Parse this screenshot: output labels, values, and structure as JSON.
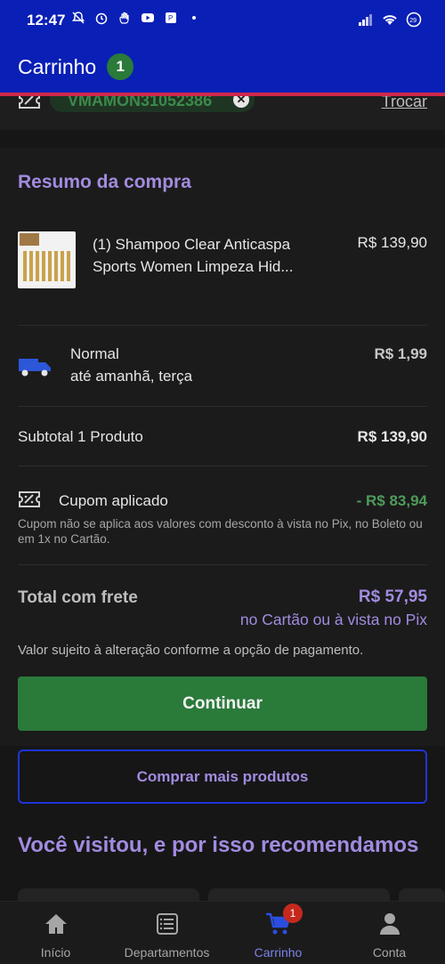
{
  "status_bar": {
    "time": "12:47",
    "battery": "29",
    "icons": [
      "mute-bell-icon",
      "alarm-icon",
      "hand-icon",
      "youtube-icon",
      "app-icon",
      "dot-icon",
      "signal-icon",
      "wifi-icon",
      "battery-icon"
    ]
  },
  "header": {
    "title": "Carrinho",
    "badge": "1",
    "bg_color": "#0a1fb5",
    "accent_line": "#d1284a"
  },
  "coupon_strip": {
    "code": "VMAMON31052386",
    "change_label": "Trocar"
  },
  "summary": {
    "title": "Resumo da compra",
    "product": {
      "name": "(1) Shampoo Clear Anticaspa Sports Women Limpeza Hid...",
      "price": "R$ 139,90"
    },
    "shipping": {
      "type": "Normal",
      "eta": "até amanhã, terça",
      "price": "R$ 1,99"
    },
    "subtotal": {
      "label": "Subtotal 1 Produto",
      "value": "R$ 139,90"
    },
    "coupon": {
      "label": "Cupom aplicado",
      "value": "- R$ 83,94",
      "note": "Cupom não se aplica aos valores com desconto à vista no Pix, no Boleto ou em 1x no Cartão."
    },
    "total": {
      "label": "Total com frete",
      "value": "R$ 57,95",
      "payment": "no Cartão ou à vista no Pix",
      "note": "Valor sujeito à alteração conforme a opção de pagamento."
    },
    "continue_label": "Continuar"
  },
  "more_products_label": "Comprar mais produtos",
  "recommendations_title": "Você visitou, e por isso recomendamos",
  "bottom_nav": {
    "items": [
      {
        "label": "Início",
        "icon": "home-icon"
      },
      {
        "label": "Departamentos",
        "icon": "list-icon"
      },
      {
        "label": "Carrinho",
        "icon": "cart-icon"
      },
      {
        "label": "Conta",
        "icon": "account-icon"
      }
    ],
    "cart_badge": "1"
  },
  "colors": {
    "primary_green": "#2a7a3a",
    "accent_purple": "#a28be0",
    "blue_border": "#1e34d6"
  }
}
